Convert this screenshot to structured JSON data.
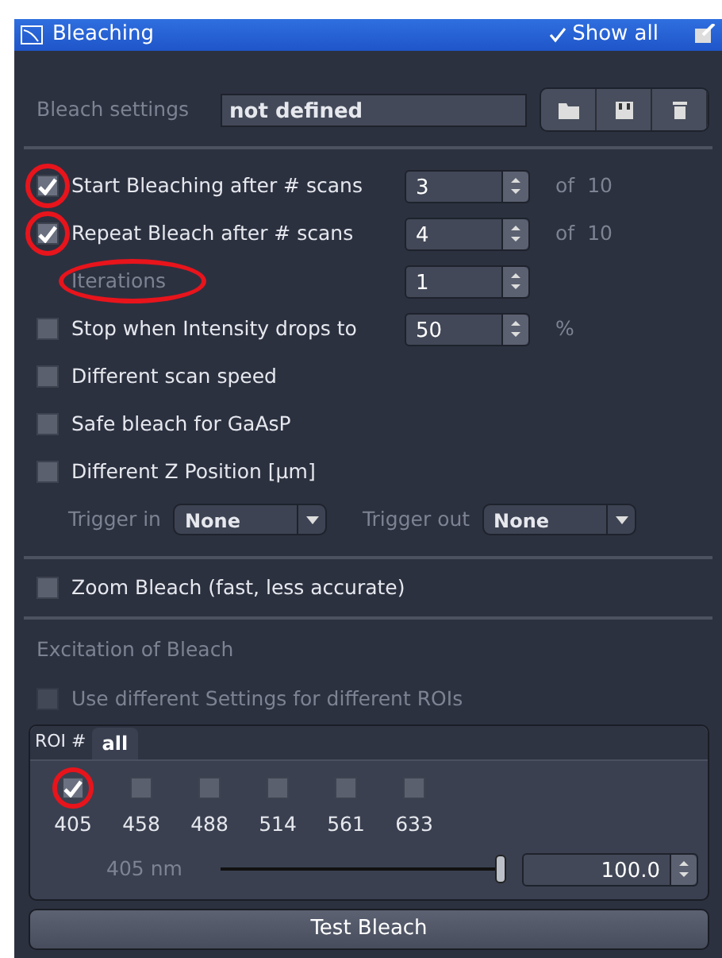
{
  "window": {
    "title": "Bleaching",
    "show_all": {
      "label": "Show all",
      "checked": true
    }
  },
  "bleach_settings": {
    "label": "Bleach settings",
    "value": "not defined"
  },
  "options": [
    {
      "kind": "spin",
      "label": "Start Bleaching after # scans",
      "checked": true,
      "circled": true,
      "value": "3",
      "suffix": "of",
      "suffix_value": "10"
    },
    {
      "kind": "spin",
      "label": "Repeat Bleach after # scans",
      "checked": true,
      "circled": true,
      "value": "4",
      "suffix": "of",
      "suffix_value": "10"
    },
    {
      "kind": "sub",
      "label": "Iterations",
      "circled": true,
      "value": "1"
    },
    {
      "kind": "spin",
      "label": "Stop when Intensity drops to",
      "checked": false,
      "circled": false,
      "value": "50",
      "suffix": "%"
    },
    {
      "kind": "check",
      "label": "Different scan speed",
      "checked": false,
      "circled": false
    },
    {
      "kind": "check",
      "label": "Safe bleach for GaAsP",
      "checked": false,
      "circled": false
    },
    {
      "kind": "check",
      "label": "Different Z Position [µm]",
      "checked": false,
      "circled": false
    }
  ],
  "triggers": [
    {
      "label": "Trigger in",
      "value": "None"
    },
    {
      "label": "Trigger out",
      "value": "None"
    }
  ],
  "zoom_bleach": {
    "label": "Zoom Bleach (fast, less accurate)",
    "checked": false
  },
  "excitation": {
    "heading": "Excitation of Bleach",
    "different_rois": {
      "label": "Use different Settings for different ROIs",
      "checked": false,
      "disabled": true
    },
    "roi_label": "ROI #",
    "tabs": [
      {
        "label": "all",
        "selected": true
      }
    ],
    "lasers": [
      {
        "label": "405",
        "checked": true,
        "circled": true
      },
      {
        "label": "458",
        "checked": false,
        "circled": false
      },
      {
        "label": "488",
        "checked": false,
        "circled": false
      },
      {
        "label": "514",
        "checked": false,
        "circled": false
      },
      {
        "label": "561",
        "checked": false,
        "circled": false
      },
      {
        "label": "633",
        "checked": false,
        "circled": false
      }
    ],
    "slider": {
      "label": "405 nm",
      "level": 1.0,
      "value": "100.0"
    }
  },
  "buttons": [
    "Test Bleach"
  ]
}
